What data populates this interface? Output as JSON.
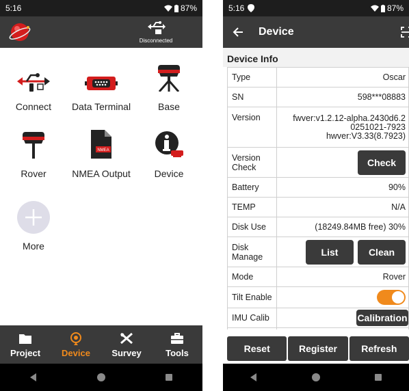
{
  "left": {
    "status": {
      "time": "5:16",
      "battery": "87%"
    },
    "appbar": {
      "usb_status": "Disconnected"
    },
    "grid": [
      {
        "label": "Connect",
        "icon": "usb-icon"
      },
      {
        "label": "Data Terminal",
        "icon": "serial-port-icon"
      },
      {
        "label": "Base",
        "icon": "base-station-icon"
      },
      {
        "label": "Rover",
        "icon": "rover-receiver-icon"
      },
      {
        "label": "NMEA Output",
        "icon": "nmea-file-icon"
      },
      {
        "label": "Device",
        "icon": "device-info-icon"
      },
      {
        "label": "More",
        "icon": "plus-icon"
      }
    ],
    "tabs": [
      {
        "label": "Project",
        "icon": "folder-icon"
      },
      {
        "label": "Device",
        "icon": "device-tab-icon"
      },
      {
        "label": "Survey",
        "icon": "survey-icon"
      },
      {
        "label": "Tools",
        "icon": "toolbox-icon"
      }
    ],
    "active_tab": "Device"
  },
  "right": {
    "status": {
      "time": "5:16",
      "battery": "87%"
    },
    "title": "Device",
    "section": "Device Info",
    "rows": {
      "type": {
        "key": "Type",
        "value": "Oscar"
      },
      "sn": {
        "key": "SN",
        "value": "598***08883"
      },
      "version": {
        "key": "Version",
        "line1": "fwver:v1.2.12-alpha.2430d6.2",
        "line2": "0251021-7923",
        "line3": "hwver:V3.33(8.7923)"
      },
      "version_check": {
        "key1": "Version",
        "key2": "Check",
        "button": "Check"
      },
      "battery": {
        "key": "Battery",
        "value": "90%"
      },
      "temp": {
        "key": "TEMP",
        "value": "N/A"
      },
      "disk_use": {
        "key": "Disk Use",
        "value": "(18249.84MB free) 30%"
      },
      "disk_manage": {
        "key1": "Disk",
        "key2": "Manage",
        "list": "List",
        "clean": "Clean"
      },
      "mode": {
        "key": "Mode",
        "value": "Rover"
      },
      "tilt": {
        "key": "Tilt Enable",
        "enabled": true
      },
      "imu": {
        "key": "IMU Calib",
        "button": "Calibration"
      }
    },
    "bottom": {
      "reset": "Reset",
      "register": "Register",
      "refresh": "Refresh"
    }
  },
  "colors": {
    "accent": "#f08a1c",
    "bar": "#3a3a3a",
    "status": "#1d1d1d"
  }
}
